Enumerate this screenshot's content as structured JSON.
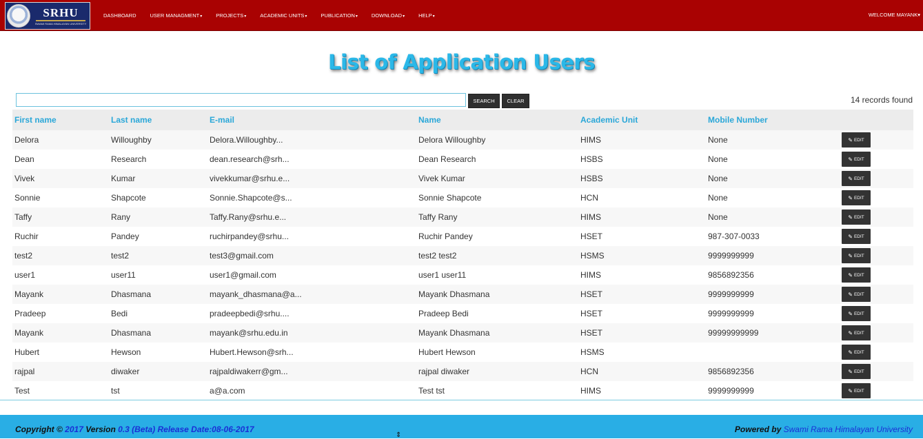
{
  "header": {
    "logo_text": "SRHU",
    "logo_sub": "SWAMI RAMA HIMALAYAN UNIVERSITY",
    "nav": [
      {
        "label": "DASHBOARD",
        "dropdown": false
      },
      {
        "label": "USER MANAGMENT",
        "dropdown": true
      },
      {
        "label": "PROJECTS",
        "dropdown": true
      },
      {
        "label": "ACADEMIC UNITS",
        "dropdown": true
      },
      {
        "label": "PUBLICATION",
        "dropdown": true
      },
      {
        "label": "DOWNLOAD",
        "dropdown": true
      },
      {
        "label": "HELP",
        "dropdown": true
      }
    ],
    "welcome": "WELCOME MAYANK",
    "colors": {
      "navbar": "#a90202"
    }
  },
  "page": {
    "title": "List of Application Users",
    "search_value": "",
    "search_label": "SEARCH",
    "clear_label": "CLEAR",
    "records": "14 records found"
  },
  "table": {
    "columns": [
      "First name",
      "Last name",
      "E-mail",
      "Name",
      "Academic Unit",
      "Mobile Number"
    ],
    "edit_label": "EDIT",
    "rows": [
      [
        "Delora",
        "Willoughby",
        "Delora.Willoughby...",
        "Delora Willoughby",
        "HIMS",
        "None"
      ],
      [
        "Dean",
        "Research",
        "dean.research@srh...",
        "Dean Research",
        "HSBS",
        "None"
      ],
      [
        "Vivek",
        "Kumar",
        "vivekkumar@srhu.e...",
        "Vivek Kumar",
        "HSBS",
        "None"
      ],
      [
        "Sonnie",
        "Shapcote",
        "Sonnie.Shapcote@s...",
        "Sonnie Shapcote",
        "HCN",
        "None"
      ],
      [
        "Taffy",
        "Rany",
        "Taffy.Rany@srhu.e...",
        "Taffy Rany",
        "HIMS",
        "None"
      ],
      [
        "Ruchir",
        "Pandey",
        "ruchirpandey@srhu...",
        "Ruchir Pandey",
        "HSET",
        "987-307-0033"
      ],
      [
        "test2",
        "test2",
        "test3@gmail.com",
        "test2 test2",
        "HSMS",
        "9999999999"
      ],
      [
        "user1",
        "user11",
        "user1@gmail.com",
        "user1 user11",
        "HIMS",
        "9856892356"
      ],
      [
        "Mayank",
        "Dhasmana",
        "mayank_dhasmana@a...",
        "Mayank Dhasmana",
        "HSET",
        "9999999999"
      ],
      [
        "Pradeep",
        "Bedi",
        "pradeepbedi@srhu....",
        "Pradeep Bedi",
        "HSET",
        "9999999999"
      ],
      [
        "Mayank",
        "Dhasmana",
        "mayank@srhu.edu.in",
        "Mayank Dhasmana",
        "HSET",
        "99999999999"
      ],
      [
        "Hubert",
        "Hewson",
        "Hubert.Hewson@srh...",
        "Hubert Hewson",
        "HSMS",
        ""
      ],
      [
        "rajpal",
        "diwaker",
        "rajpaldiwakerr@gm...",
        "rajpal diwaker",
        "HCN",
        "9856892356"
      ],
      [
        "Test",
        "tst",
        "a@a.com",
        "Test tst",
        "HIMS",
        "9999999999"
      ]
    ]
  },
  "footer": {
    "copyright_prefix": "Copyright © ",
    "year": "2017",
    "version_label": " Version ",
    "version": "0.3 (Beta) Release Date:08-06-2017",
    "powered_label": "Powered by ",
    "powered_by": "Swami Rama Himalayan University"
  }
}
